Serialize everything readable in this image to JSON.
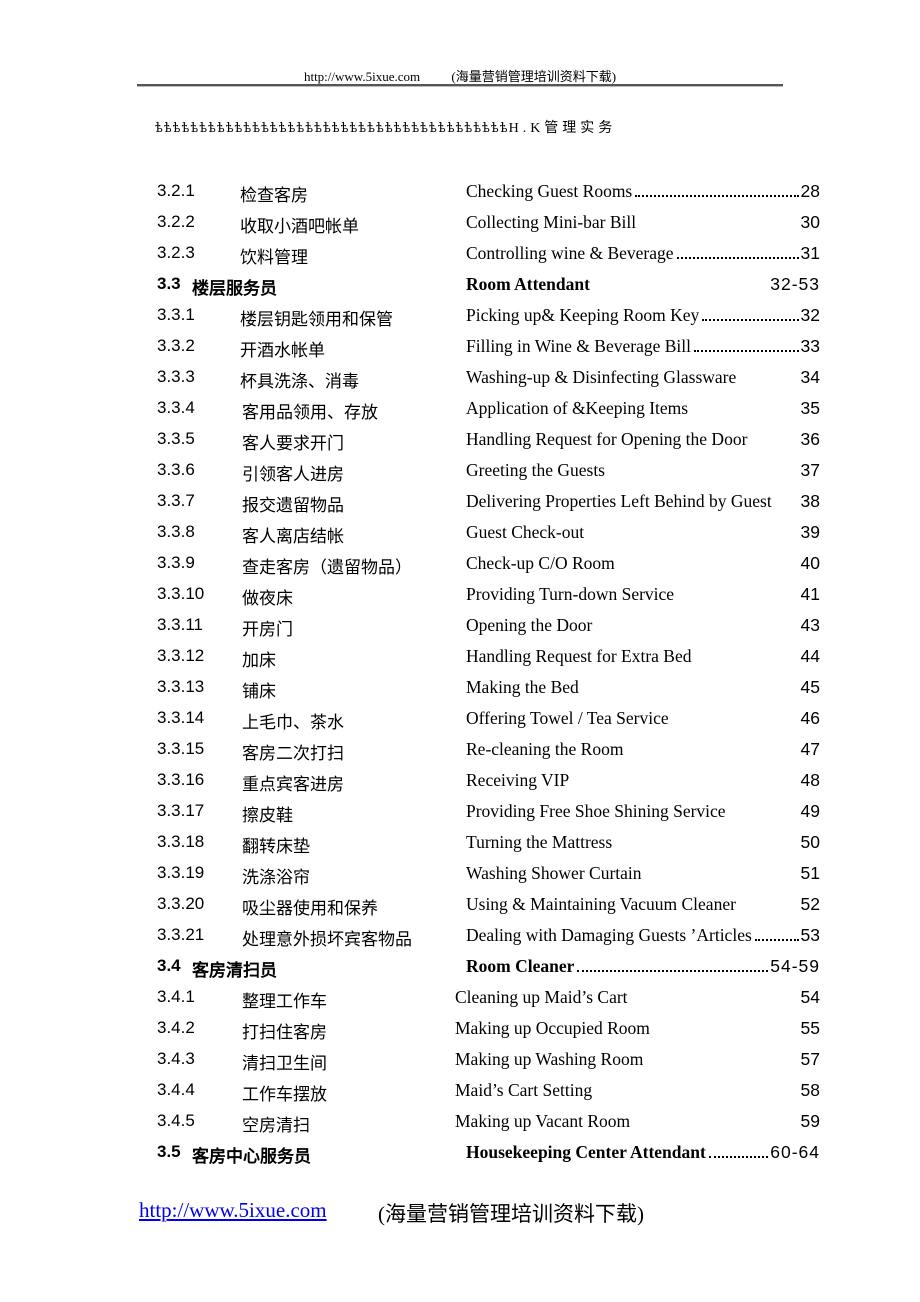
{
  "header": {
    "url": "http://www.5ixue.com",
    "note": "(海量营销管理培训资料下载)"
  },
  "ornament": {
    "glyphs": "ѣѣѣѣѣѣѣѣѣѣѣѣѣѣѣѣѣѣѣѣѣѣѣѣѣѣѣѣѣѣѣѣѣѣѣѣѣѣѣѣ",
    "title": "H.K管理实务"
  },
  "toc": [
    {
      "num": "3.2.1",
      "zh": "检查客房",
      "en": "Checking Guest Rooms",
      "page": "28",
      "leader": true
    },
    {
      "num": "3.2.2",
      "zh": "收取小酒吧帐单",
      "en": "Collecting Mini-bar Bill",
      "page": "30"
    },
    {
      "num": "3.2.3",
      "zh": "饮料管理",
      "en": "Controlling wine & Beverage",
      "page": "31",
      "leader": true
    },
    {
      "num": "3.3",
      "zh": "楼层服务员",
      "en": "Room Attendant",
      "page": "32-53",
      "bold": true
    },
    {
      "num": "3.3.1",
      "zh": "楼层钥匙领用和保管",
      "en": "Picking up& Keeping Room Key",
      "page": "32",
      "leader": true
    },
    {
      "num": "3.3.2",
      "zh": "开酒水帐单",
      "en": "Filling in Wine & Beverage Bill",
      "page": "33",
      "leader": true
    },
    {
      "num": "3.3.3",
      "zh": "杯具洗涤、消毒",
      "en": "Washing-up & Disinfecting Glassware",
      "page": "34"
    },
    {
      "num": "3.3.4",
      "zh": "客用品领用、存放",
      "en": "Application of &Keeping Items",
      "page": "35"
    },
    {
      "num": "3.3.5",
      "zh": "客人要求开门",
      "en": "Handling Request for Opening the Door",
      "page": "36"
    },
    {
      "num": "3.3.6",
      "zh": "引领客人进房",
      "en": "Greeting the Guests",
      "page": "37"
    },
    {
      "num": "3.3.7",
      "zh": "报交遗留物品",
      "en": "Delivering Properties Left Behind by Guest",
      "page": "38"
    },
    {
      "num": "3.3.8",
      "zh": "客人离店结帐",
      "en": "Guest Check-out",
      "page": "39"
    },
    {
      "num": "3.3.9",
      "zh": "查走客房（遗留物品）",
      "en": "Check-up C/O Room",
      "page": "40"
    },
    {
      "num": "3.3.10",
      "zh": "做夜床",
      "en": "Providing Turn-down Service",
      "page": "41"
    },
    {
      "num": "3.3.11",
      "zh": "开房门",
      "en": "Opening the Door",
      "page": "43"
    },
    {
      "num": "3.3.12",
      "zh": "加床",
      "en": "Handling Request for Extra Bed",
      "page": "44"
    },
    {
      "num": "3.3.13",
      "zh": "铺床",
      "en": "Making the Bed",
      "page": "45"
    },
    {
      "num": "3.3.14",
      "zh": "上毛巾、茶水",
      "en": "Offering Towel / Tea Service",
      "page": "46"
    },
    {
      "num": "3.3.15",
      "zh": "客房二次打扫",
      "en": "Re-cleaning the Room",
      "page": "47"
    },
    {
      "num": "3.3.16",
      "zh": "重点宾客进房",
      "en": "Receiving VIP",
      "page": "48"
    },
    {
      "num": "3.3.17",
      "zh": "擦皮鞋",
      "en": "Providing Free Shoe Shining Service",
      "page": "49"
    },
    {
      "num": "3.3.18",
      "zh": "翻转床垫",
      "en": "Turning the Mattress",
      "page": "50"
    },
    {
      "num": "3.3.19",
      "zh": "洗涤浴帘",
      "en": "Washing Shower Curtain",
      "page": "51"
    },
    {
      "num": "3.3.20",
      "zh": "吸尘器使用和保养",
      "en": "Using & Maintaining Vacuum Cleaner",
      "page": "52"
    },
    {
      "num": "3.3.21",
      "zh": "处理意外损坏宾客物品",
      "en": "Dealing with Damaging Guests ’Articles",
      "page": "53",
      "leader": true
    },
    {
      "num": "3.4",
      "zh": "客房清扫员",
      "en": "Room Cleaner",
      "page": "54-59",
      "bold": true,
      "leader": true
    },
    {
      "num": "3.4.1",
      "zh": "整理工作车",
      "en": "Cleaning up Maid’s Cart",
      "page": "54"
    },
    {
      "num": "3.4.2",
      "zh": "打扫住客房",
      "en": "Making up Occupied Room",
      "page": "55"
    },
    {
      "num": "3.4.3",
      "zh": "清扫卫生间",
      "en": "Making up Washing Room",
      "page": "57"
    },
    {
      "num": "3.4.4",
      "zh": "工作车摆放",
      "en": "Maid’s Cart Setting",
      "page": "58"
    },
    {
      "num": "3.4.5",
      "zh": "空房清扫",
      "en": "Making up Vacant Room",
      "page": "59"
    },
    {
      "num": "3.5",
      "zh": "客房中心服务员",
      "en": "Housekeeping Center Attendant",
      "page": "60-64",
      "bold": true,
      "leader": true
    }
  ],
  "footer": {
    "url": "http://www.5ixue.com",
    "note": "(海量营销管理培训资料下载)",
    "link_color": "#0000ee"
  }
}
